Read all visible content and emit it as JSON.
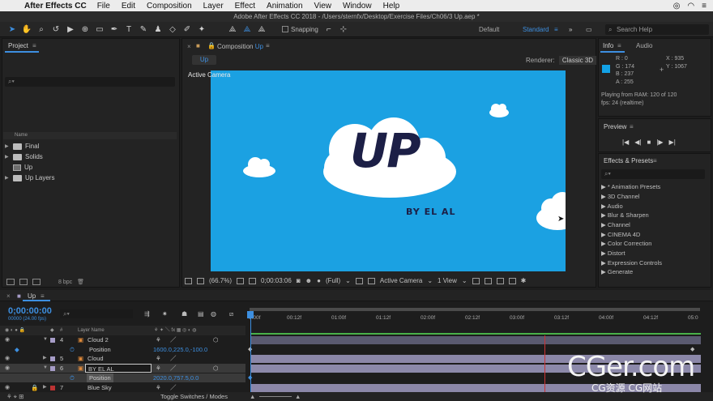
{
  "menubar": {
    "app_name": "After Effects CC",
    "items": [
      "File",
      "Edit",
      "Composition",
      "Layer",
      "Effect",
      "Animation",
      "View",
      "Window",
      "Help"
    ]
  },
  "window": {
    "title": "Adobe After Effects CC 2018 - /Users/sternfx/Desktop/Exercise Files/Ch06/3 Up.aep *"
  },
  "toolbar": {
    "snapping_label": "Snapping",
    "workspaces": [
      "Default",
      "Standard"
    ],
    "active_workspace": "Standard",
    "search_placeholder": "Search Help"
  },
  "project": {
    "tab": "Project",
    "search_placeholder": "",
    "column_name": "Name",
    "items": [
      {
        "label": "Final",
        "kind": "folder"
      },
      {
        "label": "Solids",
        "kind": "folder"
      },
      {
        "label": "Up",
        "kind": "comp"
      },
      {
        "label": "Up Layers",
        "kind": "folder"
      }
    ],
    "bpc": "8 bpc"
  },
  "composition": {
    "tab_prefix": "Composition",
    "tab_name": "Up",
    "subtab": "Up",
    "renderer_label": "Renderer:",
    "renderer_value": "Classic 3D",
    "view_label": "Active Camera",
    "logo_text": "UP",
    "logo_sub": "BY EL AL",
    "footer": {
      "zoom": "(66.7%)",
      "timecode": "0;00:03:06",
      "resolution": "(Full)",
      "camera": "Active Camera",
      "views": "1 View"
    }
  },
  "info": {
    "tabs": [
      "Info",
      "Audio"
    ],
    "active_tab": "Info",
    "r": "R : 0",
    "g": "G : 174",
    "b": "B : 237",
    "a": "A : 255",
    "x": "X : 935",
    "y": "Y : 1067",
    "playing": "Playing from RAM: 120 of 120",
    "fps": "fps: 24 (realtime)",
    "swatch_color": "#12a2e6"
  },
  "preview": {
    "tab": "Preview"
  },
  "effects": {
    "tab": "Effects & Presets",
    "items": [
      "* Animation Presets",
      "3D Channel",
      "Audio",
      "Blur & Sharpen",
      "Channel",
      "CINEMA 4D",
      "Color Correction",
      "Distort",
      "Expression Controls",
      "Generate"
    ]
  },
  "timeline": {
    "tab": "Up",
    "timecode": "0;00:00:00",
    "timecode_sub": "00000 (24.00 fps)",
    "search_placeholder": "",
    "col_layer_name": "Layer Name",
    "ruler_ticks": [
      "0:00f",
      "00:12f",
      "01:00f",
      "01:12f",
      "02:00f",
      "02:12f",
      "03:00f",
      "03:12f",
      "04:00f",
      "04:12f",
      "05:0"
    ],
    "rows": [
      {
        "num": "4",
        "name": "Cloud 2",
        "type": "layer"
      },
      {
        "prop": "Position",
        "value": "1600.0,225.0,-100.0",
        "type": "prop"
      },
      {
        "num": "5",
        "name": "Cloud",
        "type": "layer"
      },
      {
        "num": "6",
        "name": "BY EL AL",
        "type": "layer-edit"
      },
      {
        "prop": "Position",
        "value": "2020.0,757.5,0.0",
        "type": "prop"
      },
      {
        "num": "7",
        "name": "Blue Sky",
        "type": "layer"
      }
    ],
    "footer": "Toggle Switches / Modes"
  },
  "watermark": {
    "main": "CGer.com",
    "sub": "CG资源 CG网站"
  }
}
